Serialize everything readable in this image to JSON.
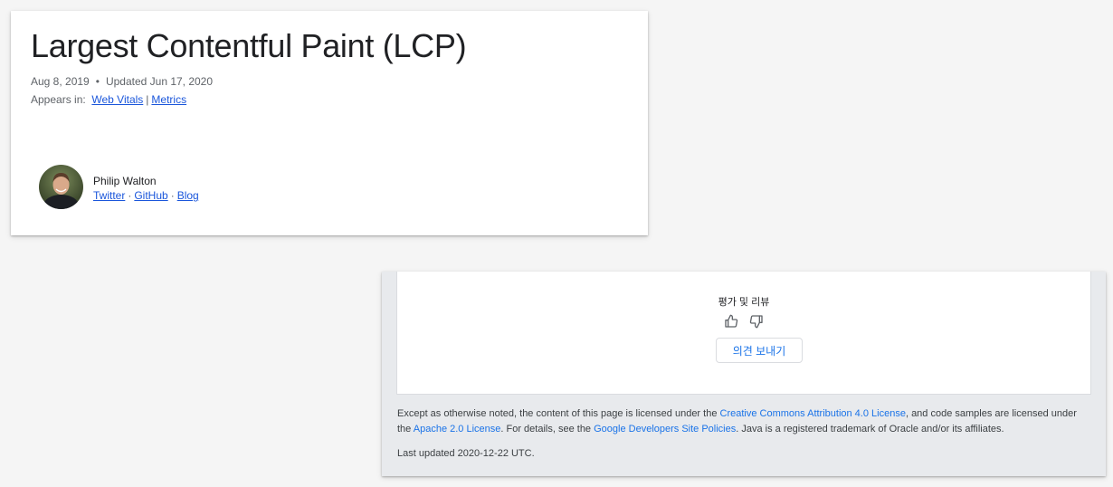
{
  "article": {
    "title": "Largest Contentful Paint (LCP)",
    "published": "Aug 8, 2019",
    "dot": "•",
    "updated": "Updated Jun 17, 2020",
    "appears_in_label": "Appears in:",
    "appears_links": [
      "Web Vitals",
      "Metrics"
    ],
    "appears_sep": "|"
  },
  "author": {
    "name": "Philip Walton",
    "links": [
      "Twitter",
      "GitHub",
      "Blog"
    ],
    "sep": "·"
  },
  "feedback": {
    "label": "평가 및 리뷰",
    "thumbs_up_icon": "thumbs-up-icon",
    "thumbs_down_icon": "thumbs-down-icon",
    "send_button": "의견 보내기"
  },
  "footer": {
    "license_part1": "Except as otherwise noted, the content of this page is licensed under the ",
    "cc_link": "Creative Commons Attribution 4.0 License",
    "license_part2": ", and code samples are licensed under the ",
    "apache_link": "Apache 2.0 License",
    "license_part3": ". For details, see the ",
    "policies_link": "Google Developers Site Policies",
    "license_part4": ". Java is a registered trademark of Oracle and/or its affiliates.",
    "last_updated": "Last updated 2020-12-22 UTC."
  },
  "colors": {
    "link_blue": "#1a56db",
    "footer_link": "#1a73e8",
    "page_bg": "#f5f5f5",
    "footer_bg": "#e8eaed"
  }
}
